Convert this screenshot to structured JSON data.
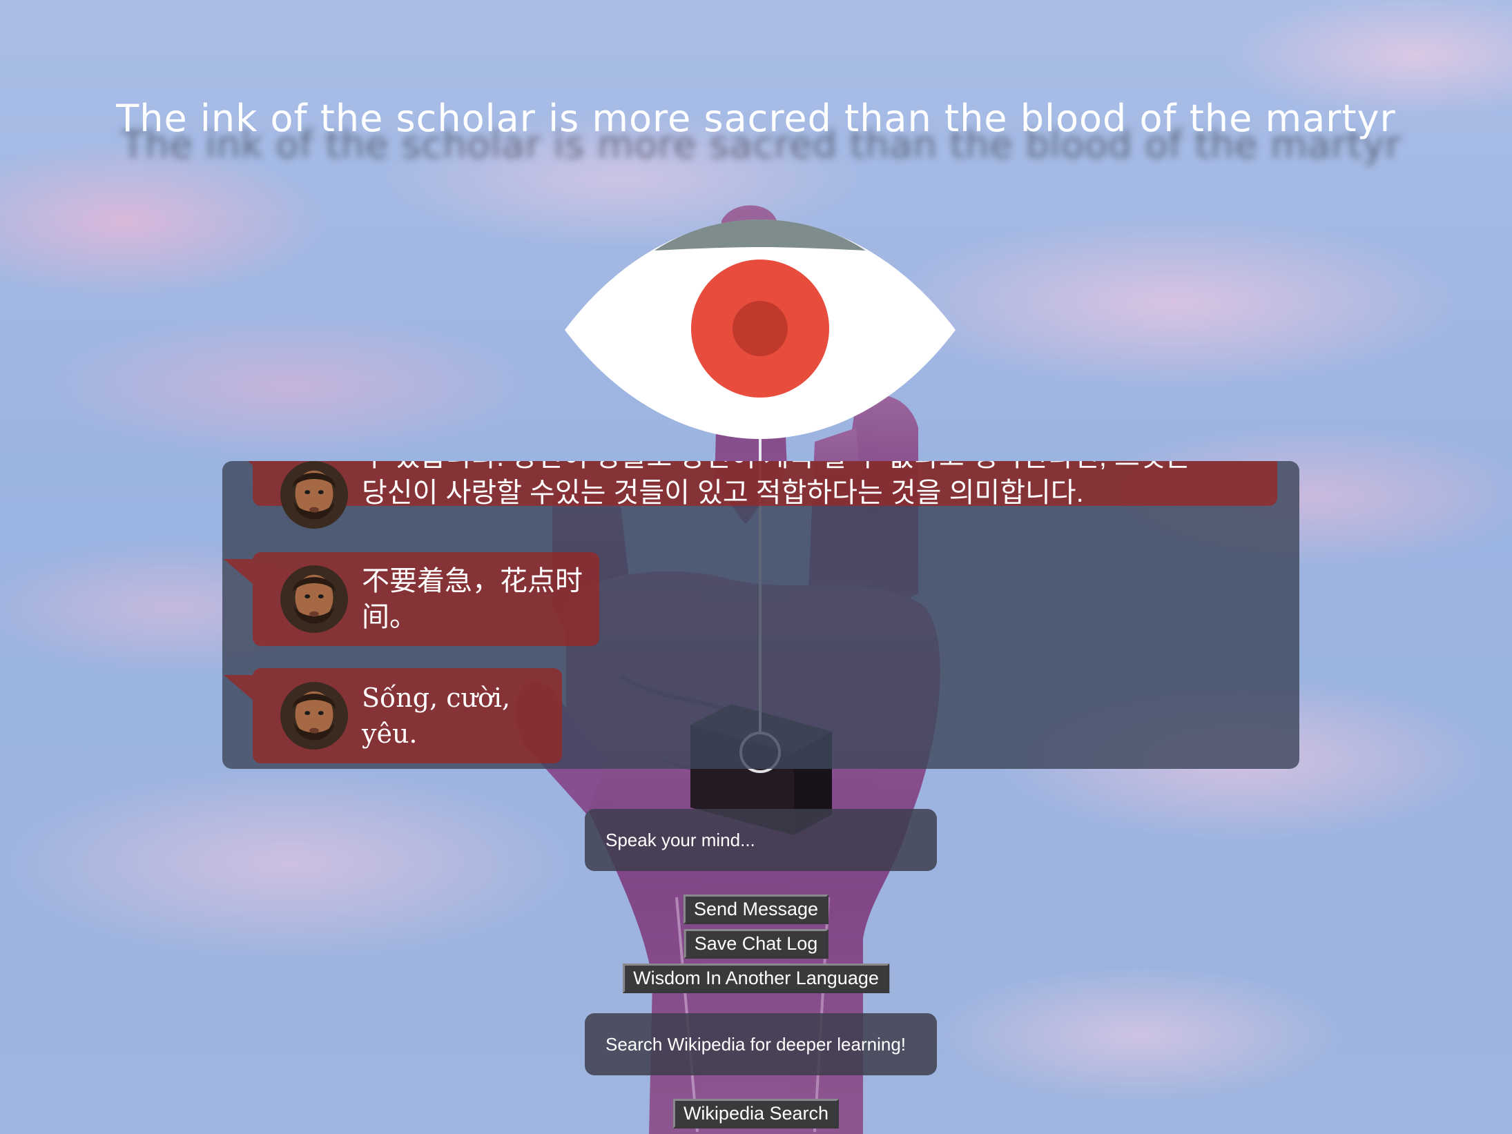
{
  "header": {
    "quote": "The ink of the scholar is more sacred than the blood of the martyr"
  },
  "chat": {
    "messages": [
      {
        "line1": "수 있습니다. 당신이 당을도 당신이 계속 할 수 없다고 생각한다면, 그것은",
        "line2": "당신이 사랑할 수있는 것들이 있고 적합하다는 것을 의미합니다."
      },
      {
        "text": "不要着急，花点时间。"
      },
      {
        "text": "Sống, cười, yêu."
      }
    ]
  },
  "composer": {
    "placeholder": "Speak your mind...",
    "send_label": "Send Message",
    "save_label": "Save Chat Log",
    "language_label": "Wisdom In Another Language"
  },
  "wikipedia": {
    "placeholder": "Search Wikipedia for deeper learning!",
    "search_label": "Wikipedia Search"
  },
  "colors": {
    "sky": "#9eb6e0",
    "bubble": "#962828",
    "panel": "#3e485c",
    "iris": "#e74c3c",
    "pupil": "#c0392b",
    "eyelid": "#7f8c8d"
  },
  "icons": {
    "eye": "eye-icon",
    "avatar": "bearded-man-avatar"
  }
}
